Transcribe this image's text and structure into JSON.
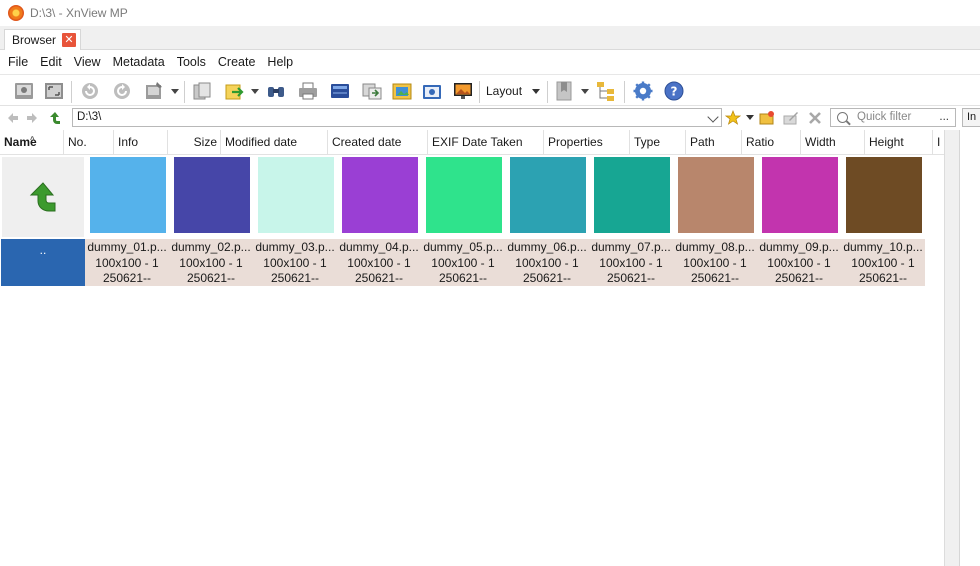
{
  "window": {
    "title": "D:\\3\\ - XnView MP"
  },
  "tabs": [
    {
      "label": "Browser",
      "close_icon": "close-icon"
    }
  ],
  "menu": [
    "File",
    "Edit",
    "View",
    "Metadata",
    "Tools",
    "Create",
    "Help"
  ],
  "toolbar": {
    "layout_label": "Layout",
    "icons": [
      "view-icon",
      "fullscreen-icon",
      "rotate-left-icon",
      "rotate-right-icon",
      "tag-icon",
      "copy-icon",
      "move-icon",
      "find-icon",
      "print-icon",
      "scan-icon",
      "convert-icon",
      "batch-icon",
      "slideshow-icon",
      "wallpaper-icon",
      "bookmark-icon",
      "tree-icon",
      "settings-icon",
      "help-icon"
    ]
  },
  "address": {
    "path": "D:\\3\\",
    "quick_filter_placeholder": "Quick filter",
    "quick_filter_more": "...",
    "right_pane_label": "In"
  },
  "columns": [
    "Name",
    "No.",
    "Info",
    "Size",
    "Modified date",
    "Created date",
    "EXIF Date Taken",
    "Properties",
    "Type",
    "Path",
    "Ratio",
    "Width",
    "Height",
    "I"
  ],
  "parent_item": {
    "label": ".."
  },
  "files": [
    {
      "name": "dummy_01.p...",
      "dims": "100x100 - 1",
      "date": "250621--",
      "color": "#55b2eb"
    },
    {
      "name": "dummy_02.p...",
      "dims": "100x100 - 1",
      "date": "250621--",
      "color": "#4646a8"
    },
    {
      "name": "dummy_03.p...",
      "dims": "100x100 - 1",
      "date": "250621--",
      "color": "#c8f5ea"
    },
    {
      "name": "dummy_04.p...",
      "dims": "100x100 - 1",
      "date": "250621--",
      "color": "#9a3fd4"
    },
    {
      "name": "dummy_05.p...",
      "dims": "100x100 - 1",
      "date": "250621--",
      "color": "#2fe38c"
    },
    {
      "name": "dummy_06.p...",
      "dims": "100x100 - 1",
      "date": "250621--",
      "color": "#2ca2b2"
    },
    {
      "name": "dummy_07.p...",
      "dims": "100x100 - 1",
      "date": "250621--",
      "color": "#17a693"
    },
    {
      "name": "dummy_08.p...",
      "dims": "100x100 - 1",
      "date": "250621--",
      "color": "#b8866c"
    },
    {
      "name": "dummy_09.p...",
      "dims": "100x100 - 1",
      "date": "250621--",
      "color": "#c234ae"
    },
    {
      "name": "dummy_10.p...",
      "dims": "100x100 - 1",
      "date": "250621--",
      "color": "#6e4b24"
    }
  ]
}
